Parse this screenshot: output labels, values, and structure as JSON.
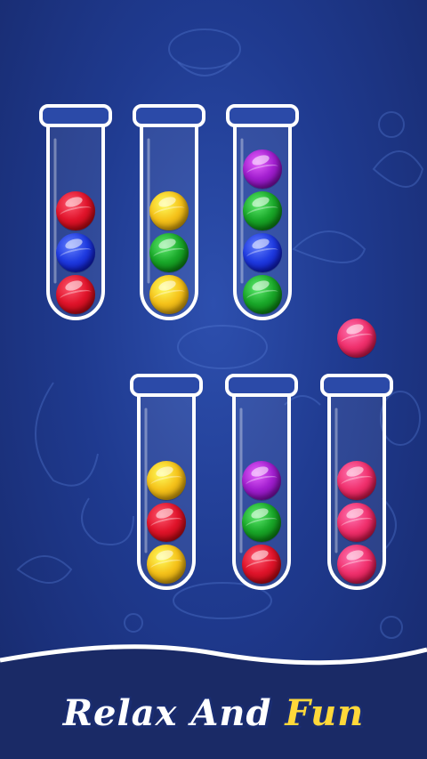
{
  "colors": {
    "red": "#e0142b",
    "blue": "#1f3be0",
    "yellow": "#f5c21a",
    "green": "#1aa82a",
    "purple": "#a21fcf",
    "pink": "#f0316e",
    "accent_yellow": "#ffd83a",
    "background": "#1f3a8f"
  },
  "tubes": [
    {
      "id": 1,
      "balls": [
        "red",
        "blue",
        "red"
      ]
    },
    {
      "id": 2,
      "balls": [
        "yellow",
        "green",
        "yellow"
      ]
    },
    {
      "id": 3,
      "balls": [
        "purple",
        "green",
        "blue",
        "green"
      ]
    },
    {
      "id": 4,
      "balls": [
        "yellow",
        "red",
        "yellow"
      ]
    },
    {
      "id": 5,
      "balls": [
        "purple",
        "green",
        "red"
      ]
    },
    {
      "id": 6,
      "balls": [
        "pink",
        "pink",
        "pink"
      ]
    }
  ],
  "floating_ball": "pink",
  "slogan": {
    "word1": "Relax",
    "word2": "And",
    "word3": "Fun"
  }
}
